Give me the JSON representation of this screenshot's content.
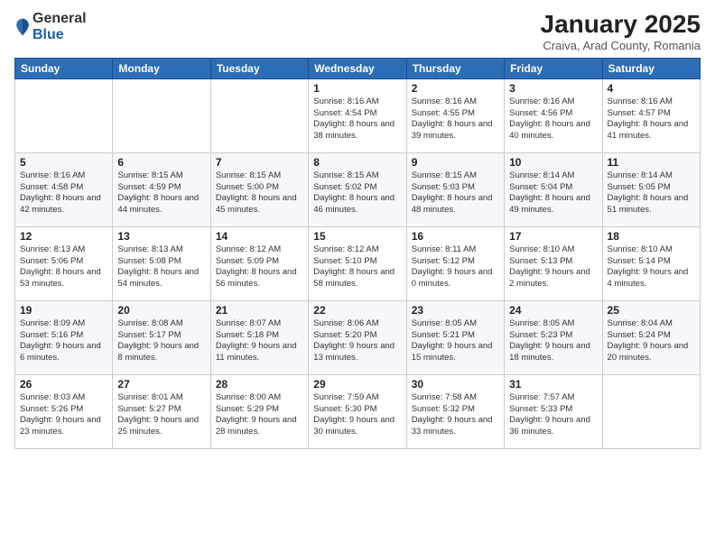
{
  "header": {
    "logo_general": "General",
    "logo_blue": "Blue",
    "month_title": "January 2025",
    "subtitle": "Craiva, Arad County, Romania"
  },
  "weekdays": [
    "Sunday",
    "Monday",
    "Tuesday",
    "Wednesday",
    "Thursday",
    "Friday",
    "Saturday"
  ],
  "weeks": [
    [
      {
        "day": "",
        "sunrise": "",
        "sunset": "",
        "daylight": ""
      },
      {
        "day": "",
        "sunrise": "",
        "sunset": "",
        "daylight": ""
      },
      {
        "day": "",
        "sunrise": "",
        "sunset": "",
        "daylight": ""
      },
      {
        "day": "1",
        "sunrise": "Sunrise: 8:16 AM",
        "sunset": "Sunset: 4:54 PM",
        "daylight": "Daylight: 8 hours and 38 minutes."
      },
      {
        "day": "2",
        "sunrise": "Sunrise: 8:16 AM",
        "sunset": "Sunset: 4:55 PM",
        "daylight": "Daylight: 8 hours and 39 minutes."
      },
      {
        "day": "3",
        "sunrise": "Sunrise: 8:16 AM",
        "sunset": "Sunset: 4:56 PM",
        "daylight": "Daylight: 8 hours and 40 minutes."
      },
      {
        "day": "4",
        "sunrise": "Sunrise: 8:16 AM",
        "sunset": "Sunset: 4:57 PM",
        "daylight": "Daylight: 8 hours and 41 minutes."
      }
    ],
    [
      {
        "day": "5",
        "sunrise": "Sunrise: 8:16 AM",
        "sunset": "Sunset: 4:58 PM",
        "daylight": "Daylight: 8 hours and 42 minutes."
      },
      {
        "day": "6",
        "sunrise": "Sunrise: 8:15 AM",
        "sunset": "Sunset: 4:59 PM",
        "daylight": "Daylight: 8 hours and 44 minutes."
      },
      {
        "day": "7",
        "sunrise": "Sunrise: 8:15 AM",
        "sunset": "Sunset: 5:00 PM",
        "daylight": "Daylight: 8 hours and 45 minutes."
      },
      {
        "day": "8",
        "sunrise": "Sunrise: 8:15 AM",
        "sunset": "Sunset: 5:02 PM",
        "daylight": "Daylight: 8 hours and 46 minutes."
      },
      {
        "day": "9",
        "sunrise": "Sunrise: 8:15 AM",
        "sunset": "Sunset: 5:03 PM",
        "daylight": "Daylight: 8 hours and 48 minutes."
      },
      {
        "day": "10",
        "sunrise": "Sunrise: 8:14 AM",
        "sunset": "Sunset: 5:04 PM",
        "daylight": "Daylight: 8 hours and 49 minutes."
      },
      {
        "day": "11",
        "sunrise": "Sunrise: 8:14 AM",
        "sunset": "Sunset: 5:05 PM",
        "daylight": "Daylight: 8 hours and 51 minutes."
      }
    ],
    [
      {
        "day": "12",
        "sunrise": "Sunrise: 8:13 AM",
        "sunset": "Sunset: 5:06 PM",
        "daylight": "Daylight: 8 hours and 53 minutes."
      },
      {
        "day": "13",
        "sunrise": "Sunrise: 8:13 AM",
        "sunset": "Sunset: 5:08 PM",
        "daylight": "Daylight: 8 hours and 54 minutes."
      },
      {
        "day": "14",
        "sunrise": "Sunrise: 8:12 AM",
        "sunset": "Sunset: 5:09 PM",
        "daylight": "Daylight: 8 hours and 56 minutes."
      },
      {
        "day": "15",
        "sunrise": "Sunrise: 8:12 AM",
        "sunset": "Sunset: 5:10 PM",
        "daylight": "Daylight: 8 hours and 58 minutes."
      },
      {
        "day": "16",
        "sunrise": "Sunrise: 8:11 AM",
        "sunset": "Sunset: 5:12 PM",
        "daylight": "Daylight: 9 hours and 0 minutes."
      },
      {
        "day": "17",
        "sunrise": "Sunrise: 8:10 AM",
        "sunset": "Sunset: 5:13 PM",
        "daylight": "Daylight: 9 hours and 2 minutes."
      },
      {
        "day": "18",
        "sunrise": "Sunrise: 8:10 AM",
        "sunset": "Sunset: 5:14 PM",
        "daylight": "Daylight: 9 hours and 4 minutes."
      }
    ],
    [
      {
        "day": "19",
        "sunrise": "Sunrise: 8:09 AM",
        "sunset": "Sunset: 5:16 PM",
        "daylight": "Daylight: 9 hours and 6 minutes."
      },
      {
        "day": "20",
        "sunrise": "Sunrise: 8:08 AM",
        "sunset": "Sunset: 5:17 PM",
        "daylight": "Daylight: 9 hours and 8 minutes."
      },
      {
        "day": "21",
        "sunrise": "Sunrise: 8:07 AM",
        "sunset": "Sunset: 5:18 PM",
        "daylight": "Daylight: 9 hours and 11 minutes."
      },
      {
        "day": "22",
        "sunrise": "Sunrise: 8:06 AM",
        "sunset": "Sunset: 5:20 PM",
        "daylight": "Daylight: 9 hours and 13 minutes."
      },
      {
        "day": "23",
        "sunrise": "Sunrise: 8:05 AM",
        "sunset": "Sunset: 5:21 PM",
        "daylight": "Daylight: 9 hours and 15 minutes."
      },
      {
        "day": "24",
        "sunrise": "Sunrise: 8:05 AM",
        "sunset": "Sunset: 5:23 PM",
        "daylight": "Daylight: 9 hours and 18 minutes."
      },
      {
        "day": "25",
        "sunrise": "Sunrise: 8:04 AM",
        "sunset": "Sunset: 5:24 PM",
        "daylight": "Daylight: 9 hours and 20 minutes."
      }
    ],
    [
      {
        "day": "26",
        "sunrise": "Sunrise: 8:03 AM",
        "sunset": "Sunset: 5:26 PM",
        "daylight": "Daylight: 9 hours and 23 minutes."
      },
      {
        "day": "27",
        "sunrise": "Sunrise: 8:01 AM",
        "sunset": "Sunset: 5:27 PM",
        "daylight": "Daylight: 9 hours and 25 minutes."
      },
      {
        "day": "28",
        "sunrise": "Sunrise: 8:00 AM",
        "sunset": "Sunset: 5:29 PM",
        "daylight": "Daylight: 9 hours and 28 minutes."
      },
      {
        "day": "29",
        "sunrise": "Sunrise: 7:59 AM",
        "sunset": "Sunset: 5:30 PM",
        "daylight": "Daylight: 9 hours and 30 minutes."
      },
      {
        "day": "30",
        "sunrise": "Sunrise: 7:58 AM",
        "sunset": "Sunset: 5:32 PM",
        "daylight": "Daylight: 9 hours and 33 minutes."
      },
      {
        "day": "31",
        "sunrise": "Sunrise: 7:57 AM",
        "sunset": "Sunset: 5:33 PM",
        "daylight": "Daylight: 9 hours and 36 minutes."
      },
      {
        "day": "",
        "sunrise": "",
        "sunset": "",
        "daylight": ""
      }
    ]
  ]
}
